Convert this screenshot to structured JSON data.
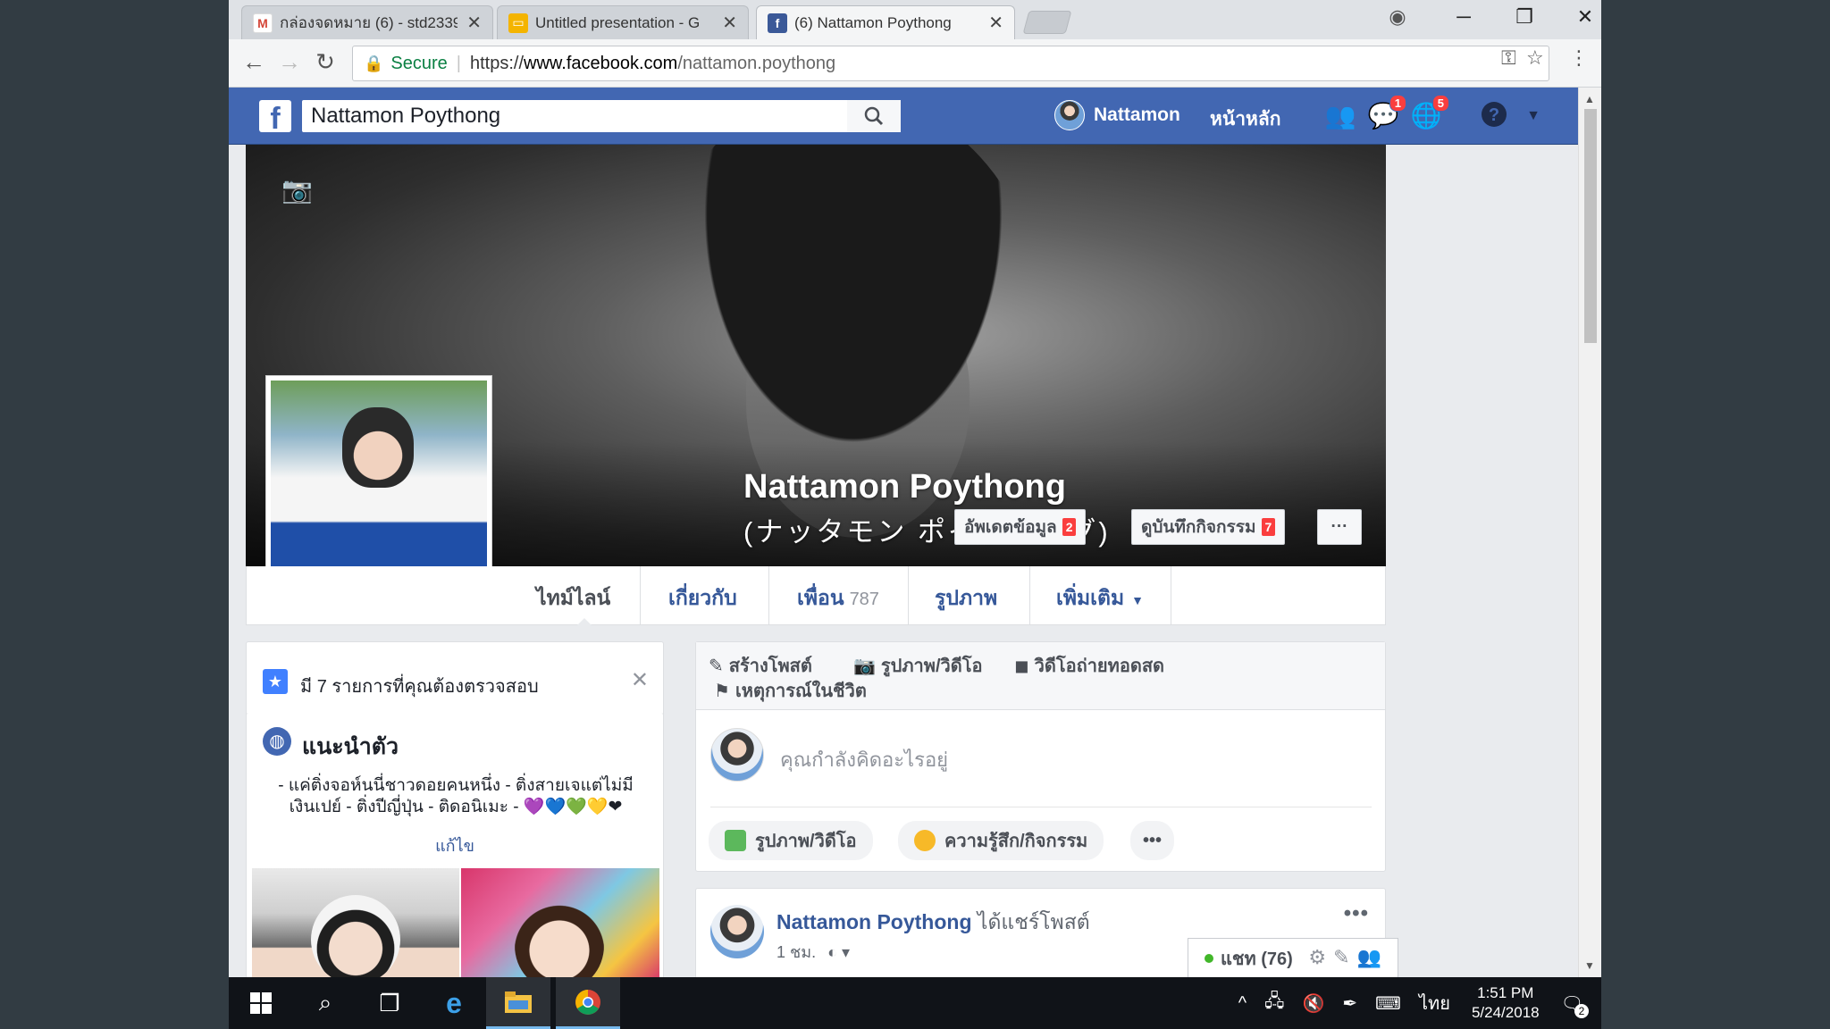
{
  "browser": {
    "tabs": [
      {
        "title": "กล่องจดหมาย (6) - std2339",
        "icon": "gmail-icon"
      },
      {
        "title": "Untitled presentation - G",
        "icon": "slides-icon"
      },
      {
        "title": "(6) Nattamon Poythong",
        "icon": "facebook-icon"
      }
    ],
    "secure_label": "Secure",
    "url_scheme": "https://",
    "url_host": "www.facebook.com",
    "url_path": "/nattamon.poythong"
  },
  "facebook": {
    "search_value": "Nattamon Poythong",
    "user_name": "Nattamon",
    "home_label": "หน้าหลัก",
    "messages_badge": "1",
    "notifications_badge": "5",
    "brand_color": "#4267b2"
  },
  "profile": {
    "name": "Nattamon Poythong",
    "alt_name": "(ナッタモン ポイトーング)",
    "update_info_label": "อัพเดตข้อมูล",
    "update_info_count": "2",
    "activity_log_label": "ดูบันทึกกิจกรรม",
    "activity_log_count": "7",
    "more_dots": "···",
    "nav": {
      "timeline": "ไทม์ไลน์",
      "about": "เกี่ยวกับ",
      "friends": "เพื่อน",
      "friends_count": "787",
      "photos": "รูปภาพ",
      "more": "เพิ่มเติม"
    }
  },
  "review": {
    "text": "มี 7 รายการที่คุณต้องตรวจสอบ"
  },
  "intro": {
    "title": "แนะนำตัว",
    "bio_line1": "- แค่ติ่งจอห์นนี่ชาวดอยคนหนึ่ง - ติ่งสายเจแต่ไม่มี",
    "bio_line2": "เงินเปย์ - ติ่งปีญี่ปุ่น - ติดอนิเมะ - 💜💙💚💛❤",
    "edit_label": "แก้ไข"
  },
  "composer": {
    "tab_post": "สร้างโพสต์",
    "tab_photo": "รูปภาพ/วิดีโอ",
    "tab_live": "วิดีโอถ่ายทอดสด",
    "tab_life_event": "เหตุการณ์ในชีวิต",
    "placeholder": "คุณกำลังคิดอะไรอยู่",
    "chip_photo": "รูปภาพ/วิดีโอ",
    "chip_feeling": "ความรู้สึก/กิจกรรม",
    "chip_more": "•••"
  },
  "post": {
    "author": "Nattamon Poythong",
    "action": "ได้แชร์โพสต์",
    "time": "1 ชม.",
    "more": "•••"
  },
  "chat": {
    "label": "แชท (76)"
  },
  "taskbar": {
    "language": "ไทย",
    "time": "1:51 PM",
    "date": "5/24/2018",
    "notif_count": "2"
  }
}
